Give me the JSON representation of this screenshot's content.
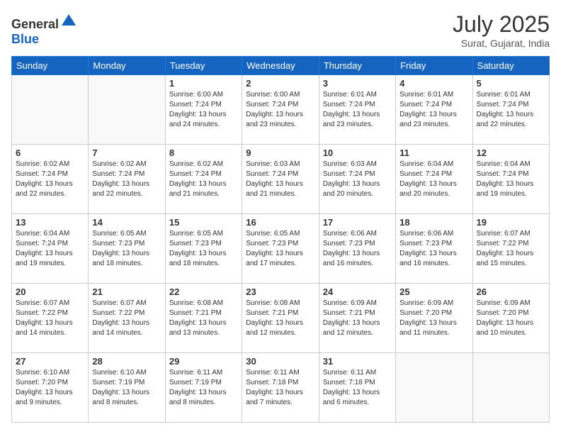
{
  "header": {
    "logo": {
      "general": "General",
      "blue": "Blue"
    },
    "title": "July 2025",
    "location": "Surat, Gujarat, India"
  },
  "days_of_week": [
    "Sunday",
    "Monday",
    "Tuesday",
    "Wednesday",
    "Thursday",
    "Friday",
    "Saturday"
  ],
  "weeks": [
    [
      {
        "day": "",
        "empty": true
      },
      {
        "day": "",
        "empty": true
      },
      {
        "day": "1",
        "sunrise": "6:00 AM",
        "sunset": "7:24 PM",
        "daylight": "13 hours and 24 minutes."
      },
      {
        "day": "2",
        "sunrise": "6:00 AM",
        "sunset": "7:24 PM",
        "daylight": "13 hours and 23 minutes."
      },
      {
        "day": "3",
        "sunrise": "6:01 AM",
        "sunset": "7:24 PM",
        "daylight": "13 hours and 23 minutes."
      },
      {
        "day": "4",
        "sunrise": "6:01 AM",
        "sunset": "7:24 PM",
        "daylight": "13 hours and 23 minutes."
      },
      {
        "day": "5",
        "sunrise": "6:01 AM",
        "sunset": "7:24 PM",
        "daylight": "13 hours and 22 minutes."
      }
    ],
    [
      {
        "day": "6",
        "sunrise": "6:02 AM",
        "sunset": "7:24 PM",
        "daylight": "13 hours and 22 minutes."
      },
      {
        "day": "7",
        "sunrise": "6:02 AM",
        "sunset": "7:24 PM",
        "daylight": "13 hours and 22 minutes."
      },
      {
        "day": "8",
        "sunrise": "6:02 AM",
        "sunset": "7:24 PM",
        "daylight": "13 hours and 21 minutes."
      },
      {
        "day": "9",
        "sunrise": "6:03 AM",
        "sunset": "7:24 PM",
        "daylight": "13 hours and 21 minutes."
      },
      {
        "day": "10",
        "sunrise": "6:03 AM",
        "sunset": "7:24 PM",
        "daylight": "13 hours and 20 minutes."
      },
      {
        "day": "11",
        "sunrise": "6:04 AM",
        "sunset": "7:24 PM",
        "daylight": "13 hours and 20 minutes."
      },
      {
        "day": "12",
        "sunrise": "6:04 AM",
        "sunset": "7:24 PM",
        "daylight": "13 hours and 19 minutes."
      }
    ],
    [
      {
        "day": "13",
        "sunrise": "6:04 AM",
        "sunset": "7:24 PM",
        "daylight": "13 hours and 19 minutes."
      },
      {
        "day": "14",
        "sunrise": "6:05 AM",
        "sunset": "7:23 PM",
        "daylight": "13 hours and 18 minutes."
      },
      {
        "day": "15",
        "sunrise": "6:05 AM",
        "sunset": "7:23 PM",
        "daylight": "13 hours and 18 minutes."
      },
      {
        "day": "16",
        "sunrise": "6:05 AM",
        "sunset": "7:23 PM",
        "daylight": "13 hours and 17 minutes."
      },
      {
        "day": "17",
        "sunrise": "6:06 AM",
        "sunset": "7:23 PM",
        "daylight": "13 hours and 16 minutes."
      },
      {
        "day": "18",
        "sunrise": "6:06 AM",
        "sunset": "7:23 PM",
        "daylight": "13 hours and 16 minutes."
      },
      {
        "day": "19",
        "sunrise": "6:07 AM",
        "sunset": "7:22 PM",
        "daylight": "13 hours and 15 minutes."
      }
    ],
    [
      {
        "day": "20",
        "sunrise": "6:07 AM",
        "sunset": "7:22 PM",
        "daylight": "13 hours and 14 minutes."
      },
      {
        "day": "21",
        "sunrise": "6:07 AM",
        "sunset": "7:22 PM",
        "daylight": "13 hours and 14 minutes."
      },
      {
        "day": "22",
        "sunrise": "6:08 AM",
        "sunset": "7:21 PM",
        "daylight": "13 hours and 13 minutes."
      },
      {
        "day": "23",
        "sunrise": "6:08 AM",
        "sunset": "7:21 PM",
        "daylight": "13 hours and 12 minutes."
      },
      {
        "day": "24",
        "sunrise": "6:09 AM",
        "sunset": "7:21 PM",
        "daylight": "13 hours and 12 minutes."
      },
      {
        "day": "25",
        "sunrise": "6:09 AM",
        "sunset": "7:20 PM",
        "daylight": "13 hours and 11 minutes."
      },
      {
        "day": "26",
        "sunrise": "6:09 AM",
        "sunset": "7:20 PM",
        "daylight": "13 hours and 10 minutes."
      }
    ],
    [
      {
        "day": "27",
        "sunrise": "6:10 AM",
        "sunset": "7:20 PM",
        "daylight": "13 hours and 9 minutes."
      },
      {
        "day": "28",
        "sunrise": "6:10 AM",
        "sunset": "7:19 PM",
        "daylight": "13 hours and 8 minutes."
      },
      {
        "day": "29",
        "sunrise": "6:11 AM",
        "sunset": "7:19 PM",
        "daylight": "13 hours and 8 minutes."
      },
      {
        "day": "30",
        "sunrise": "6:11 AM",
        "sunset": "7:18 PM",
        "daylight": "13 hours and 7 minutes."
      },
      {
        "day": "31",
        "sunrise": "6:11 AM",
        "sunset": "7:18 PM",
        "daylight": "13 hours and 6 minutes."
      },
      {
        "day": "",
        "empty": true
      },
      {
        "day": "",
        "empty": true
      }
    ]
  ]
}
